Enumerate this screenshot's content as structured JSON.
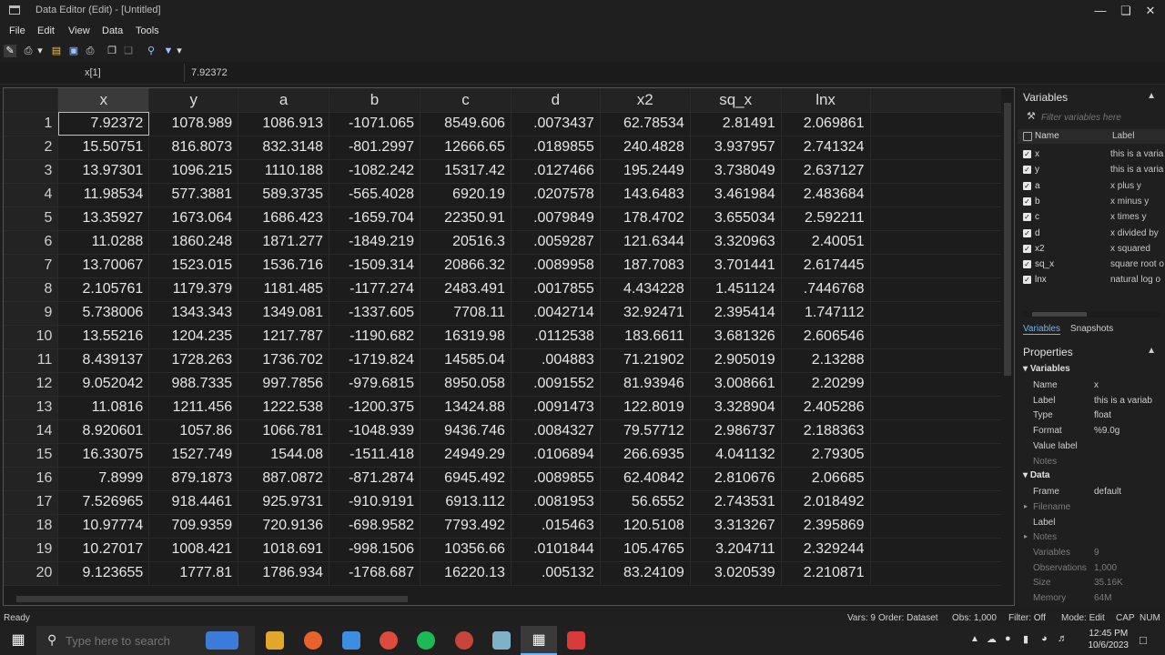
{
  "window": {
    "title": "Data Editor (Edit) - [Untitled]"
  },
  "menu": [
    "File",
    "Edit",
    "View",
    "Data",
    "Tools"
  ],
  "cellbar": {
    "name": "x[1]",
    "value": "7.92372"
  },
  "grid": {
    "columns": [
      "x",
      "y",
      "a",
      "b",
      "c",
      "d",
      "x2",
      "sq_x",
      "lnx"
    ],
    "rows": [
      [
        "7.92372",
        "1078.989",
        "1086.913",
        "-1071.065",
        "8549.606",
        ".0073437",
        "62.78534",
        "2.81491",
        "2.069861"
      ],
      [
        "15.50751",
        "816.8073",
        "832.3148",
        "-801.2997",
        "12666.65",
        ".0189855",
        "240.4828",
        "3.937957",
        "2.741324"
      ],
      [
        "13.97301",
        "1096.215",
        "1110.188",
        "-1082.242",
        "15317.42",
        ".0127466",
        "195.2449",
        "3.738049",
        "2.637127"
      ],
      [
        "11.98534",
        "577.3881",
        "589.3735",
        "-565.4028",
        "6920.19",
        ".0207578",
        "143.6483",
        "3.461984",
        "2.483684"
      ],
      [
        "13.35927",
        "1673.064",
        "1686.423",
        "-1659.704",
        "22350.91",
        ".0079849",
        "178.4702",
        "3.655034",
        "2.592211"
      ],
      [
        "11.0288",
        "1860.248",
        "1871.277",
        "-1849.219",
        "20516.3",
        ".0059287",
        "121.6344",
        "3.320963",
        "2.40051"
      ],
      [
        "13.70067",
        "1523.015",
        "1536.716",
        "-1509.314",
        "20866.32",
        ".0089958",
        "187.7083",
        "3.701441",
        "2.617445"
      ],
      [
        "2.105761",
        "1179.379",
        "1181.485",
        "-1177.274",
        "2483.491",
        ".0017855",
        "4.434228",
        "1.451124",
        ".7446768"
      ],
      [
        "5.738006",
        "1343.343",
        "1349.081",
        "-1337.605",
        "7708.11",
        ".0042714",
        "32.92471",
        "2.395414",
        "1.747112"
      ],
      [
        "13.55216",
        "1204.235",
        "1217.787",
        "-1190.682",
        "16319.98",
        ".0112538",
        "183.6611",
        "3.681326",
        "2.606546"
      ],
      [
        "8.439137",
        "1728.263",
        "1736.702",
        "-1719.824",
        "14585.04",
        ".004883",
        "71.21902",
        "2.905019",
        "2.13288"
      ],
      [
        "9.052042",
        "988.7335",
        "997.7856",
        "-979.6815",
        "8950.058",
        ".0091552",
        "81.93946",
        "3.008661",
        "2.20299"
      ],
      [
        "11.0816",
        "1211.456",
        "1222.538",
        "-1200.375",
        "13424.88",
        ".0091473",
        "122.8019",
        "3.328904",
        "2.405286"
      ],
      [
        "8.920601",
        "1057.86",
        "1066.781",
        "-1048.939",
        "9436.746",
        ".0084327",
        "79.57712",
        "2.986737",
        "2.188363"
      ],
      [
        "16.33075",
        "1527.749",
        "1544.08",
        "-1511.418",
        "24949.29",
        ".0106894",
        "266.6935",
        "4.041132",
        "2.79305"
      ],
      [
        "7.8999",
        "879.1873",
        "887.0872",
        "-871.2874",
        "6945.492",
        ".0089855",
        "62.40842",
        "2.810676",
        "2.06685"
      ],
      [
        "7.526965",
        "918.4461",
        "925.9731",
        "-910.9191",
        "6913.112",
        ".0081953",
        "56.6552",
        "2.743531",
        "2.018492"
      ],
      [
        "10.97774",
        "709.9359",
        "720.9136",
        "-698.9582",
        "7793.492",
        ".015463",
        "120.5108",
        "3.313267",
        "2.395869"
      ],
      [
        "10.27017",
        "1008.421",
        "1018.691",
        "-998.1506",
        "10356.66",
        ".0101844",
        "105.4765",
        "3.204711",
        "2.329244"
      ],
      [
        "9.123655",
        "1777.81",
        "1786.934",
        "-1768.687",
        "16220.13",
        ".005132",
        "83.24109",
        "3.020539",
        "2.210871"
      ]
    ]
  },
  "variables_panel": {
    "title": "Variables",
    "filter_placeholder": "Filter variables here",
    "header_name": "Name",
    "header_label": "Label",
    "items": [
      {
        "name": "x",
        "label": "this is a varia"
      },
      {
        "name": "y",
        "label": "this is a varia"
      },
      {
        "name": "a",
        "label": "x plus y"
      },
      {
        "name": "b",
        "label": "x minus y"
      },
      {
        "name": "c",
        "label": "x times y"
      },
      {
        "name": "d",
        "label": "x divided by"
      },
      {
        "name": "x2",
        "label": "x squared"
      },
      {
        "name": "sq_x",
        "label": "square root o"
      },
      {
        "name": "lnx",
        "label": "natural log o"
      }
    ],
    "tabs": [
      "Variables",
      "Snapshots"
    ]
  },
  "properties_panel": {
    "title": "Properties",
    "sections": [
      {
        "name": "Variables",
        "rows": [
          {
            "k": "Name",
            "v": "x"
          },
          {
            "k": "Label",
            "v": "this is a variab"
          },
          {
            "k": "Type",
            "v": "float"
          },
          {
            "k": "Format",
            "v": "%9.0g"
          },
          {
            "k": "Value label",
            "v": ""
          },
          {
            "k": "Notes",
            "v": "",
            "dim": true
          }
        ]
      },
      {
        "name": "Data",
        "rows": [
          {
            "k": "Frame",
            "v": "default"
          },
          {
            "k": "Filename",
            "v": "",
            "dim": true,
            "arrow": true
          },
          {
            "k": "Label",
            "v": ""
          },
          {
            "k": "Notes",
            "v": "",
            "dim": true,
            "arrow": true
          },
          {
            "k": "Variables",
            "v": "9",
            "dim": true
          },
          {
            "k": "Observations",
            "v": "1,000",
            "dim": true
          },
          {
            "k": "Size",
            "v": "35.16K",
            "dim": true
          },
          {
            "k": "Memory",
            "v": "64M",
            "dim": true
          }
        ]
      }
    ]
  },
  "status": {
    "left": "Ready",
    "vars": "Vars: 9",
    "order": "Order: Dataset",
    "obs": "Obs: 1,000",
    "filter": "Filter: Off",
    "mode": "Mode: Edit",
    "cap": "CAP",
    "num": "NUM"
  },
  "taskbar": {
    "search_placeholder": "Type here to search",
    "time": "12:45 PM",
    "date": "10/6/2023"
  },
  "colors": {
    "accent": "#3a8ee6",
    "bg": "#1e1e1e",
    "panel": "#1f1f1f"
  }
}
